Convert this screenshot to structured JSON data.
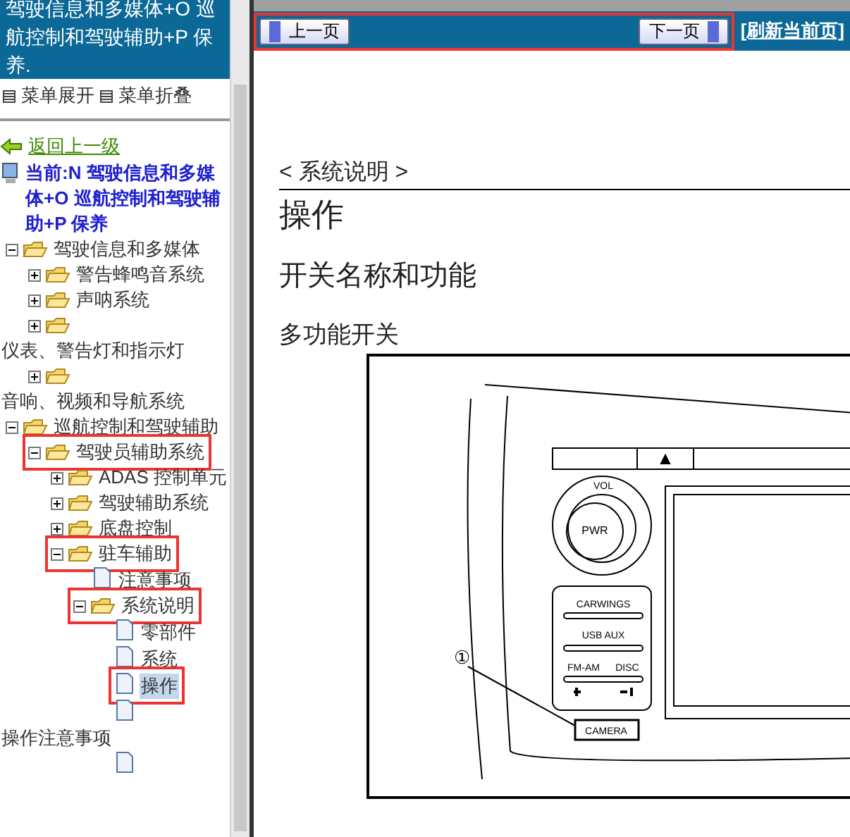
{
  "sidebar": {
    "title": "驾驶信息和多媒体+O 巡航控制和驾驶辅助+P 保养.",
    "menu_actions": [
      "菜单展开",
      "菜单折叠"
    ],
    "back_link": "返回上一级",
    "current": "当前:N 驾驶信息和多媒体+O 巡航控制和驾驶辅助+P 保养",
    "tree": [
      {
        "kind": "folder",
        "label": "驾驶信息和多媒体",
        "expanded": true,
        "children": [
          {
            "kind": "folder",
            "label": "警告蜂鸣音系统",
            "expanded": false
          },
          {
            "kind": "folder",
            "label": "声呐系统",
            "expanded": false
          },
          {
            "kind": "folder",
            "label": "仪表、警告灯和指示灯",
            "expanded": false
          },
          {
            "kind": "folder",
            "label": "音响、视频和导航系统",
            "expanded": false
          }
        ]
      },
      {
        "kind": "folder",
        "label": "巡航控制和驾驶辅助",
        "expanded": true,
        "children": [
          {
            "kind": "folder",
            "label": "驾驶员辅助系统",
            "expanded": true,
            "annotated": true,
            "children": [
              {
                "kind": "folder",
                "label": "ADAS 控制单元",
                "expanded": false
              },
              {
                "kind": "folder",
                "label": "驾驶辅助系统",
                "expanded": false
              },
              {
                "kind": "folder",
                "label": "底盘控制",
                "expanded": false
              },
              {
                "kind": "folder",
                "label": "驻车辅助",
                "expanded": true,
                "annotated": true,
                "children": [
                  {
                    "kind": "page",
                    "label": "注意事项",
                    "selected": false
                  },
                  {
                    "kind": "folder",
                    "label": "系统说明",
                    "expanded": true,
                    "annotated": true,
                    "children": [
                      {
                        "kind": "page",
                        "label": "零部件",
                        "selected": false
                      },
                      {
                        "kind": "page",
                        "label": "系统",
                        "selected": false
                      },
                      {
                        "kind": "page",
                        "label": "操作",
                        "selected": true,
                        "annotated": true
                      },
                      {
                        "kind": "page",
                        "label": "操作注意事项",
                        "selected": false
                      },
                      {
                        "kind": "page"
                      }
                    ]
                  }
                ]
              }
            ]
          }
        ]
      }
    ]
  },
  "toolbar": {
    "prev": "上一页",
    "next": "下一页",
    "refresh": "[刷新当前页]",
    "annotated": true
  },
  "document": {
    "section": "< 系统说明 >",
    "title": "操作",
    "heading": "开关名称和功能",
    "subheading": "多功能开关",
    "figure": {
      "knob_top": "VOL",
      "knob": "PWR",
      "buttons": [
        "CARWINGS",
        "USB AUX",
        "FM-AM",
        "DISC"
      ],
      "callout": "①",
      "camera": "CAMERA"
    }
  }
}
